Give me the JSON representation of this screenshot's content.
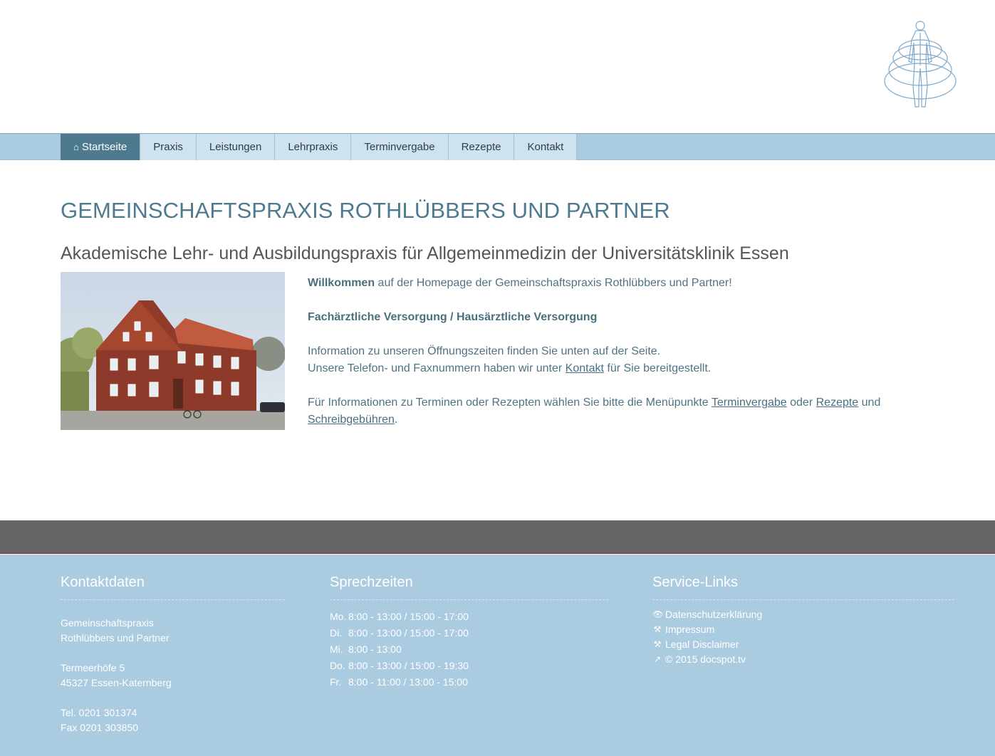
{
  "nav": {
    "items": [
      {
        "label": "Startseite",
        "active": true,
        "icon": "home-icon"
      },
      {
        "label": "Praxis"
      },
      {
        "label": "Leistungen"
      },
      {
        "label": "Lehrpraxis"
      },
      {
        "label": "Terminvergabe"
      },
      {
        "label": "Rezepte"
      },
      {
        "label": "Kontakt"
      }
    ]
  },
  "main": {
    "title": "GEMEINSCHAFTSPRAXIS ROTHLÜBBERS UND PARTNER",
    "subtitle": "Akademische Lehr- und Ausbildungspraxis für Allgemeinmedizin der Universitätsklinik Essen",
    "welcome_bold": "Willkommen",
    "welcome_rest": " auf der Homepage der Gemeinschaftspraxis Rothlübbers und Partner!",
    "care_heading": "Fachärztliche Versorgung / Hausärztliche Versorgung",
    "info_line1": "Information zu unseren Öffnungszeiten finden Sie unten auf der Seite.",
    "info_line2_pre": "Unsere Telefon- und Faxnummern haben wir unter ",
    "info_line2_link": "Kontakt",
    "info_line2_post": " für Sie bereitgestellt.",
    "info_line3_pre": "Für Informationen zu Terminen oder Rezepten wählen Sie bitte die Menüpunkte ",
    "info_line3_link1": "Terminvergabe",
    "info_line3_mid": " oder ",
    "info_line3_link2": "Rezepte",
    "info_line3_and": " und ",
    "info_line3_link3": "Schreibgebühren",
    "info_line3_end": "."
  },
  "footer": {
    "contact": {
      "heading": "Kontaktdaten",
      "name1": "Gemeinschaftspraxis",
      "name2": "Rothlübbers und Partner",
      "street": "Termeerhöfe 5",
      "city": "45327 Essen-Katernberg",
      "tel": "Tel. 0201 301374",
      "fax": "Fax 0201 303850"
    },
    "hours": {
      "heading": "Sprechzeiten",
      "rows": [
        {
          "day": "Mo.",
          "times": "8:00 - 13:00 / 15:00 - 17:00"
        },
        {
          "day": "Di.",
          "times": "8:00 - 13:00 / 15:00 - 17:00"
        },
        {
          "day": "Mi.",
          "times": "8:00 - 13:00"
        },
        {
          "day": "Do.",
          "times": "8:00 - 13:00 / 15:00 - 19:30"
        },
        {
          "day": "Fr.",
          "times": "8:00 - 11:00 / 13:00 - 15:00"
        }
      ]
    },
    "links": {
      "heading": "Service-Links",
      "items": [
        {
          "label": "Datenschutzerklärung",
          "icon": "eye-icon"
        },
        {
          "label": "Impressum",
          "icon": "gavel-icon"
        },
        {
          "label": "Legal Disclaimer",
          "icon": "gavel-icon"
        },
        {
          "label": "© 2015 docspot.tv",
          "icon": "external-link-icon"
        }
      ]
    }
  }
}
